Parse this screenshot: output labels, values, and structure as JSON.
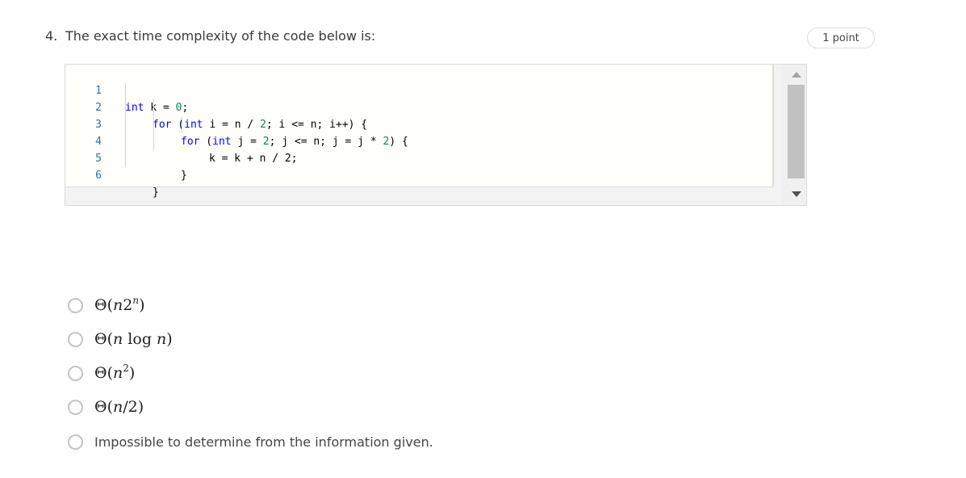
{
  "question": {
    "number": "4.",
    "text": "The exact time complexity of the code below is:",
    "points": "1 point"
  },
  "code": {
    "lines": [
      {
        "number": "1",
        "text": "int k = 0;"
      },
      {
        "number": "2",
        "text": "for (int i = n / 2; i <= n; i++) {"
      },
      {
        "number": "3",
        "text": "for (int j = 2; j <= n; j = j * 2) {"
      },
      {
        "number": "4",
        "text": "k = k + n / 2;"
      },
      {
        "number": "5",
        "text": "}"
      },
      {
        "number": "6",
        "text": "}"
      }
    ],
    "colors": {
      "keyword": "#0000ff",
      "number": "#098658",
      "line_number": "#237893"
    }
  },
  "options": [
    {
      "label": "Θ(n2^n)",
      "theta": "Θ(",
      "var": "n",
      "base": "2",
      "sup": "n",
      "close": ")",
      "selected": false
    },
    {
      "label": "Θ(n log n)",
      "theta": "Θ(",
      "var": "n",
      "log": "log",
      "var2": "n",
      "close": ")",
      "selected": false
    },
    {
      "label": "Θ(n^2)",
      "theta": "Θ(",
      "var": "n",
      "sup": "2",
      "close": ")",
      "selected": false
    },
    {
      "label": "Θ(n/2)",
      "theta": "Θ(",
      "var": "n",
      "rest": "/2",
      "close": ")",
      "selected": false
    },
    {
      "label": "Impossible to determine from the information given.",
      "selected": false
    }
  ]
}
